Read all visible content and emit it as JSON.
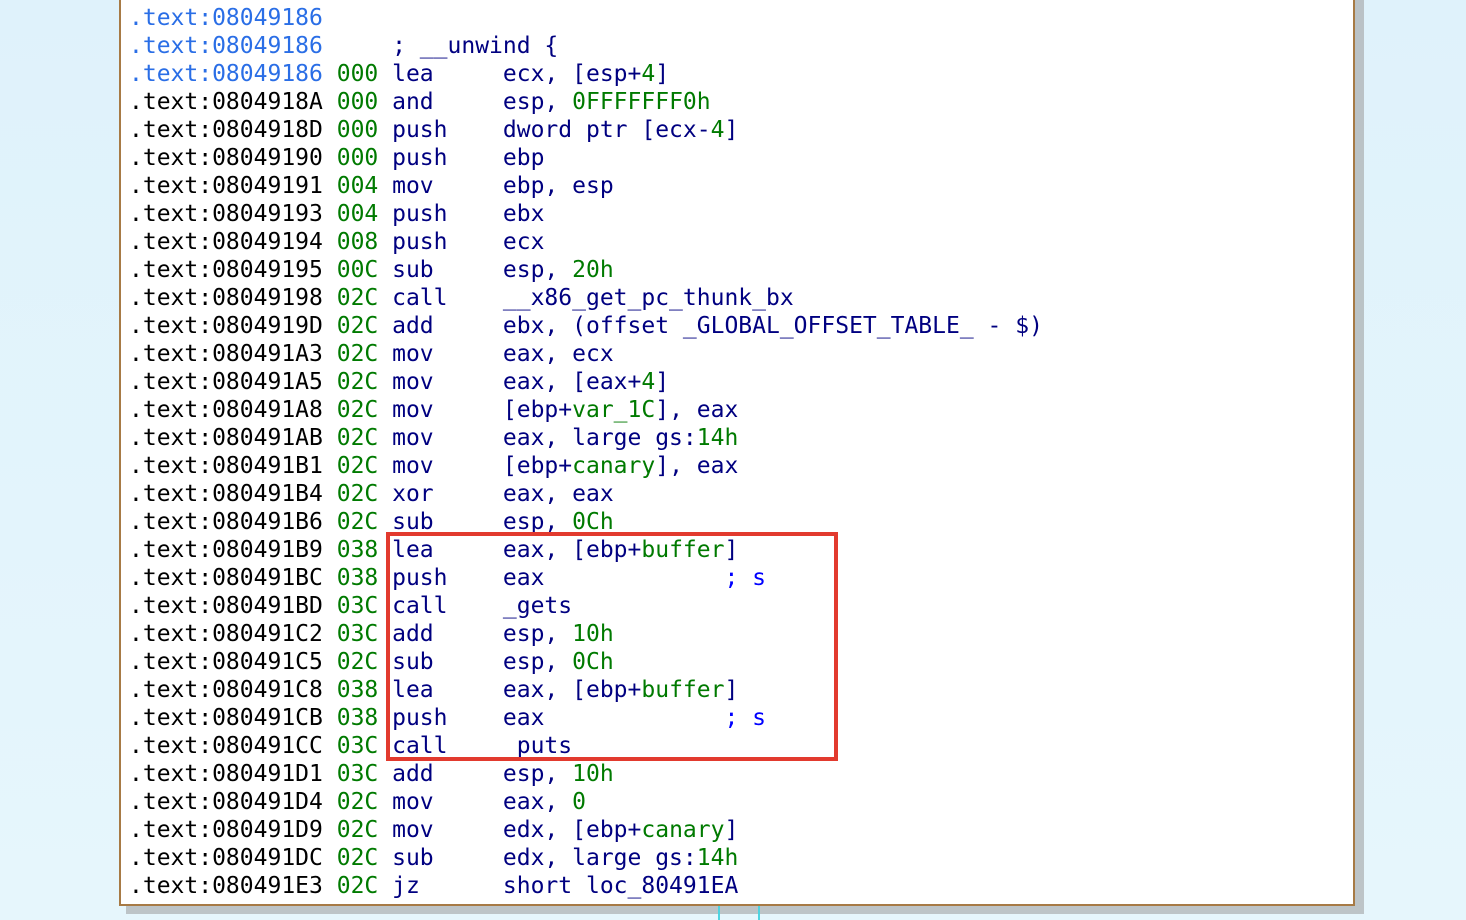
{
  "lines": [
    [
      {
        "t": ".text:08049186",
        "c": "addr-hl"
      }
    ],
    [
      {
        "t": ".text:08049186",
        "c": "addr-hl"
      },
      {
        "t": "     ; __unwind {",
        "c": "mn"
      }
    ],
    [
      {
        "t": ".text:08049186",
        "c": "addr-hl"
      },
      {
        "t": " 000",
        "c": "sp"
      },
      {
        "t": " lea     ",
        "c": "mn"
      },
      {
        "t": "ecx, [esp+",
        "c": "op-reg"
      },
      {
        "t": "4",
        "c": "op-num"
      },
      {
        "t": "]",
        "c": "op-reg"
      }
    ],
    [
      {
        "t": ".text:0804918A",
        "c": "addr"
      },
      {
        "t": " 000",
        "c": "sp"
      },
      {
        "t": " and     ",
        "c": "mn"
      },
      {
        "t": "esp, ",
        "c": "op-reg"
      },
      {
        "t": "0FFFFFFF0h",
        "c": "op-num"
      }
    ],
    [
      {
        "t": ".text:0804918D",
        "c": "addr"
      },
      {
        "t": " 000",
        "c": "sp"
      },
      {
        "t": " push    ",
        "c": "mn"
      },
      {
        "t": "dword ptr [ecx-",
        "c": "op-reg"
      },
      {
        "t": "4",
        "c": "op-num"
      },
      {
        "t": "]",
        "c": "op-reg"
      }
    ],
    [
      {
        "t": ".text:08049190",
        "c": "addr"
      },
      {
        "t": " 000",
        "c": "sp"
      },
      {
        "t": " push    ",
        "c": "mn"
      },
      {
        "t": "ebp",
        "c": "op-reg"
      }
    ],
    [
      {
        "t": ".text:08049191",
        "c": "addr"
      },
      {
        "t": " 004",
        "c": "sp"
      },
      {
        "t": " mov     ",
        "c": "mn"
      },
      {
        "t": "ebp, esp",
        "c": "op-reg"
      }
    ],
    [
      {
        "t": ".text:08049193",
        "c": "addr"
      },
      {
        "t": " 004",
        "c": "sp"
      },
      {
        "t": " push    ",
        "c": "mn"
      },
      {
        "t": "ebx",
        "c": "op-reg"
      }
    ],
    [
      {
        "t": ".text:08049194",
        "c": "addr"
      },
      {
        "t": " 008",
        "c": "sp"
      },
      {
        "t": " push    ",
        "c": "mn"
      },
      {
        "t": "ecx",
        "c": "op-reg"
      }
    ],
    [
      {
        "t": ".text:08049195",
        "c": "addr"
      },
      {
        "t": " 00C",
        "c": "sp"
      },
      {
        "t": " sub     ",
        "c": "mn"
      },
      {
        "t": "esp, ",
        "c": "op-reg"
      },
      {
        "t": "20h",
        "c": "op-num"
      }
    ],
    [
      {
        "t": ".text:08049198",
        "c": "addr"
      },
      {
        "t": " 02C",
        "c": "sp"
      },
      {
        "t": " call    ",
        "c": "mn"
      },
      {
        "t": "__x86_get_pc_thunk_bx",
        "c": "op-reg"
      }
    ],
    [
      {
        "t": ".text:0804919D",
        "c": "addr"
      },
      {
        "t": " 02C",
        "c": "sp"
      },
      {
        "t": " add     ",
        "c": "mn"
      },
      {
        "t": "ebx, (offset _GLOBAL_OFFSET_TABLE_ - $)",
        "c": "op-reg"
      }
    ],
    [
      {
        "t": ".text:080491A3",
        "c": "addr"
      },
      {
        "t": " 02C",
        "c": "sp"
      },
      {
        "t": " mov     ",
        "c": "mn"
      },
      {
        "t": "eax, ecx",
        "c": "op-reg"
      }
    ],
    [
      {
        "t": ".text:080491A5",
        "c": "addr"
      },
      {
        "t": " 02C",
        "c": "sp"
      },
      {
        "t": " mov     ",
        "c": "mn"
      },
      {
        "t": "eax, [eax+",
        "c": "op-reg"
      },
      {
        "t": "4",
        "c": "op-num"
      },
      {
        "t": "]",
        "c": "op-reg"
      }
    ],
    [
      {
        "t": ".text:080491A8",
        "c": "addr"
      },
      {
        "t": " 02C",
        "c": "sp"
      },
      {
        "t": " mov     ",
        "c": "mn"
      },
      {
        "t": "[ebp+",
        "c": "op-reg"
      },
      {
        "t": "var_1C",
        "c": "op-num"
      },
      {
        "t": "], eax",
        "c": "op-reg"
      }
    ],
    [
      {
        "t": ".text:080491AB",
        "c": "addr"
      },
      {
        "t": " 02C",
        "c": "sp"
      },
      {
        "t": " mov     ",
        "c": "mn"
      },
      {
        "t": "eax, large gs:",
        "c": "op-reg"
      },
      {
        "t": "14h",
        "c": "op-num"
      }
    ],
    [
      {
        "t": ".text:080491B1",
        "c": "addr"
      },
      {
        "t": " 02C",
        "c": "sp"
      },
      {
        "t": " mov     ",
        "c": "mn"
      },
      {
        "t": "[ebp+",
        "c": "op-reg"
      },
      {
        "t": "canary",
        "c": "op-num"
      },
      {
        "t": "], eax",
        "c": "op-reg"
      }
    ],
    [
      {
        "t": ".text:080491B4",
        "c": "addr"
      },
      {
        "t": " 02C",
        "c": "sp"
      },
      {
        "t": " xor     ",
        "c": "mn"
      },
      {
        "t": "eax, eax",
        "c": "op-reg"
      }
    ],
    [
      {
        "t": ".text:080491B6",
        "c": "addr"
      },
      {
        "t": " 02C",
        "c": "sp"
      },
      {
        "t": " sub     ",
        "c": "mn"
      },
      {
        "t": "esp, ",
        "c": "op-reg"
      },
      {
        "t": "0Ch",
        "c": "op-num"
      }
    ],
    [
      {
        "t": ".text:080491B9",
        "c": "addr"
      },
      {
        "t": " 038",
        "c": "sp"
      },
      {
        "t": " lea     ",
        "c": "mn"
      },
      {
        "t": "eax, [ebp+",
        "c": "op-reg"
      },
      {
        "t": "buffer",
        "c": "op-num"
      },
      {
        "t": "]",
        "c": "op-reg"
      }
    ],
    [
      {
        "t": ".text:080491BC",
        "c": "addr"
      },
      {
        "t": " 038",
        "c": "sp"
      },
      {
        "t": " push    ",
        "c": "mn"
      },
      {
        "t": "eax",
        "c": "op-reg"
      },
      {
        "t": "             ; s",
        "c": "cmt"
      }
    ],
    [
      {
        "t": ".text:080491BD",
        "c": "addr"
      },
      {
        "t": " 03C",
        "c": "sp"
      },
      {
        "t": " call    ",
        "c": "mn"
      },
      {
        "t": "_gets",
        "c": "op-reg"
      }
    ],
    [
      {
        "t": ".text:080491C2",
        "c": "addr"
      },
      {
        "t": " 03C",
        "c": "sp"
      },
      {
        "t": " add     ",
        "c": "mn"
      },
      {
        "t": "esp, ",
        "c": "op-reg"
      },
      {
        "t": "10h",
        "c": "op-num"
      }
    ],
    [
      {
        "t": ".text:080491C5",
        "c": "addr"
      },
      {
        "t": " 02C",
        "c": "sp"
      },
      {
        "t": " sub     ",
        "c": "mn"
      },
      {
        "t": "esp, ",
        "c": "op-reg"
      },
      {
        "t": "0Ch",
        "c": "op-num"
      }
    ],
    [
      {
        "t": ".text:080491C8",
        "c": "addr"
      },
      {
        "t": " 038",
        "c": "sp"
      },
      {
        "t": " lea     ",
        "c": "mn"
      },
      {
        "t": "eax, [ebp+",
        "c": "op-reg"
      },
      {
        "t": "buffer",
        "c": "op-num"
      },
      {
        "t": "]",
        "c": "op-reg"
      }
    ],
    [
      {
        "t": ".text:080491CB",
        "c": "addr"
      },
      {
        "t": " 038",
        "c": "sp"
      },
      {
        "t": " push    ",
        "c": "mn"
      },
      {
        "t": "eax",
        "c": "op-reg"
      },
      {
        "t": "             ; s",
        "c": "cmt"
      }
    ],
    [
      {
        "t": ".text:080491CC",
        "c": "addr"
      },
      {
        "t": " 03C",
        "c": "sp"
      },
      {
        "t": " call    ",
        "c": "mn"
      },
      {
        "t": "_puts",
        "c": "op-reg"
      }
    ],
    [
      {
        "t": ".text:080491D1",
        "c": "addr"
      },
      {
        "t": " 03C",
        "c": "sp"
      },
      {
        "t": " add     ",
        "c": "mn"
      },
      {
        "t": "esp, ",
        "c": "op-reg"
      },
      {
        "t": "10h",
        "c": "op-num"
      }
    ],
    [
      {
        "t": ".text:080491D4",
        "c": "addr"
      },
      {
        "t": " 02C",
        "c": "sp"
      },
      {
        "t": " mov     ",
        "c": "mn"
      },
      {
        "t": "eax, ",
        "c": "op-reg"
      },
      {
        "t": "0",
        "c": "op-num"
      }
    ],
    [
      {
        "t": ".text:080491D9",
        "c": "addr"
      },
      {
        "t": " 02C",
        "c": "sp"
      },
      {
        "t": " mov     ",
        "c": "mn"
      },
      {
        "t": "edx, [ebp+",
        "c": "op-reg"
      },
      {
        "t": "canary",
        "c": "op-num"
      },
      {
        "t": "]",
        "c": "op-reg"
      }
    ],
    [
      {
        "t": ".text:080491DC",
        "c": "addr"
      },
      {
        "t": " 02C",
        "c": "sp"
      },
      {
        "t": " sub     ",
        "c": "mn"
      },
      {
        "t": "edx, large gs:",
        "c": "op-reg"
      },
      {
        "t": "14h",
        "c": "op-num"
      }
    ],
    [
      {
        "t": ".text:080491E3",
        "c": "addr"
      },
      {
        "t": " 02C",
        "c": "sp"
      },
      {
        "t": " jz      ",
        "c": "mn"
      },
      {
        "t": "short loc_80491EA",
        "c": "op-reg"
      }
    ]
  ]
}
